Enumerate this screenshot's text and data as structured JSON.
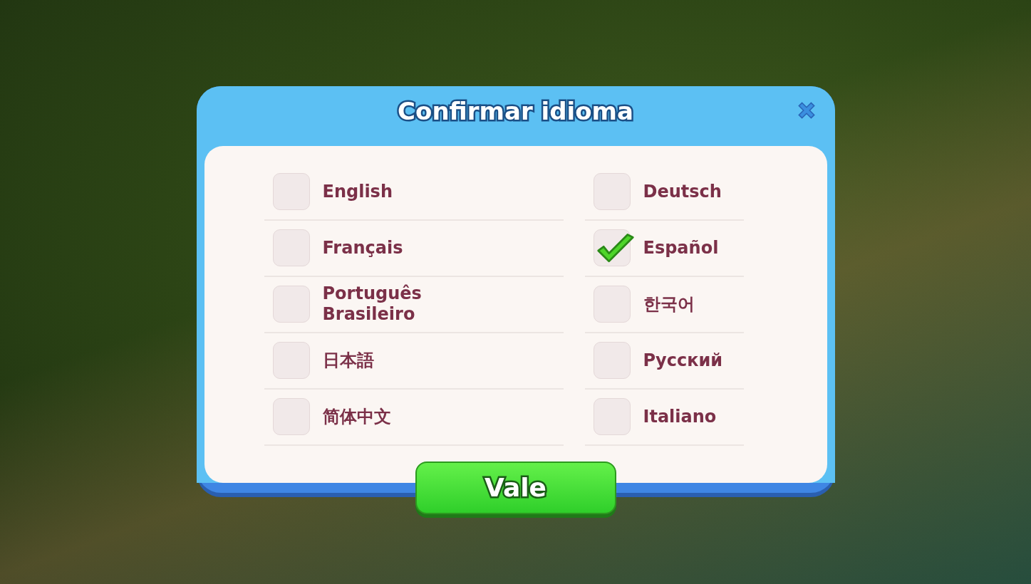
{
  "dialog": {
    "title": "Confirmar idioma",
    "languages": [
      {
        "label": "English",
        "checked": false
      },
      {
        "label": "Deutsch",
        "checked": false
      },
      {
        "label": "Français",
        "checked": false
      },
      {
        "label": "Español",
        "checked": true
      },
      {
        "label": "Português Brasileiro",
        "checked": false
      },
      {
        "label": "한국어",
        "checked": false
      },
      {
        "label": "日本語",
        "checked": false
      },
      {
        "label": "Русский",
        "checked": false
      },
      {
        "label": "简体中文",
        "checked": false
      },
      {
        "label": "Italiano",
        "checked": false
      }
    ],
    "confirm_button": "Vale"
  }
}
